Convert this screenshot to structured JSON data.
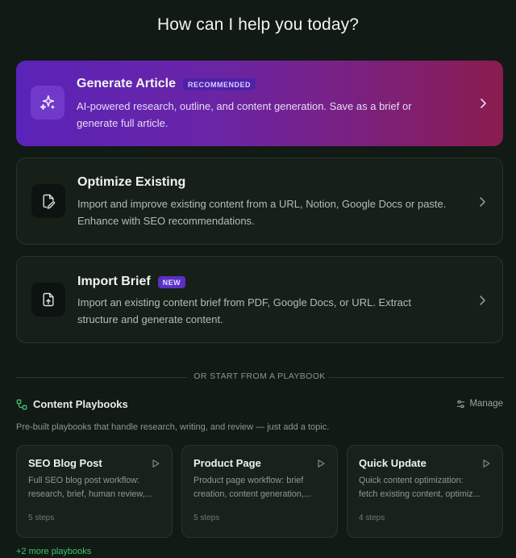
{
  "headline": "How can I help you today?",
  "options": [
    {
      "title": "Generate Article",
      "badge": "RECOMMENDED",
      "desc_line1": "AI-powered research, outline, and content generation. Save as a brief or",
      "desc_line2": "generate full article.",
      "icon": "sparkles-icon"
    },
    {
      "title": "Optimize Existing",
      "badge": "",
      "desc_line1": "Import and improve existing content from a URL, Notion, Google Docs or paste.",
      "desc_line2": "Enhance with SEO recommendations.",
      "icon": "document-edit-icon"
    },
    {
      "title": "Import Brief",
      "badge": "NEW",
      "desc_line1": "Import an existing content brief from PDF, Google Docs, or URL. Extract",
      "desc_line2": "structure and generate content.",
      "icon": "file-upload-icon"
    }
  ],
  "divider_text": "OR START FROM A PLAYBOOK",
  "playbooks": {
    "title": "Content Playbooks",
    "manage_label": "Manage",
    "subtitle": "Pre-built playbooks that handle research, writing, and review — just add a topic.",
    "cards": [
      {
        "title": "SEO Blog Post",
        "desc_line1": "Full SEO blog post workflow:",
        "desc_line2": "research, brief, human review,...",
        "steps": "5 steps"
      },
      {
        "title": "Product Page",
        "desc_line1": "Product page workflow: brief",
        "desc_line2": "creation, content generation,...",
        "steps": "5 steps"
      },
      {
        "title": "Quick Update",
        "desc_line1": "Quick content optimization:",
        "desc_line2": "fetch existing content, optimiz...",
        "steps": "4 steps"
      }
    ],
    "more_label": "+2 more playbooks"
  },
  "colors": {
    "background": "#111a15",
    "accent_green": "#3cc36e",
    "badge_purple": "#5b2fc4"
  }
}
